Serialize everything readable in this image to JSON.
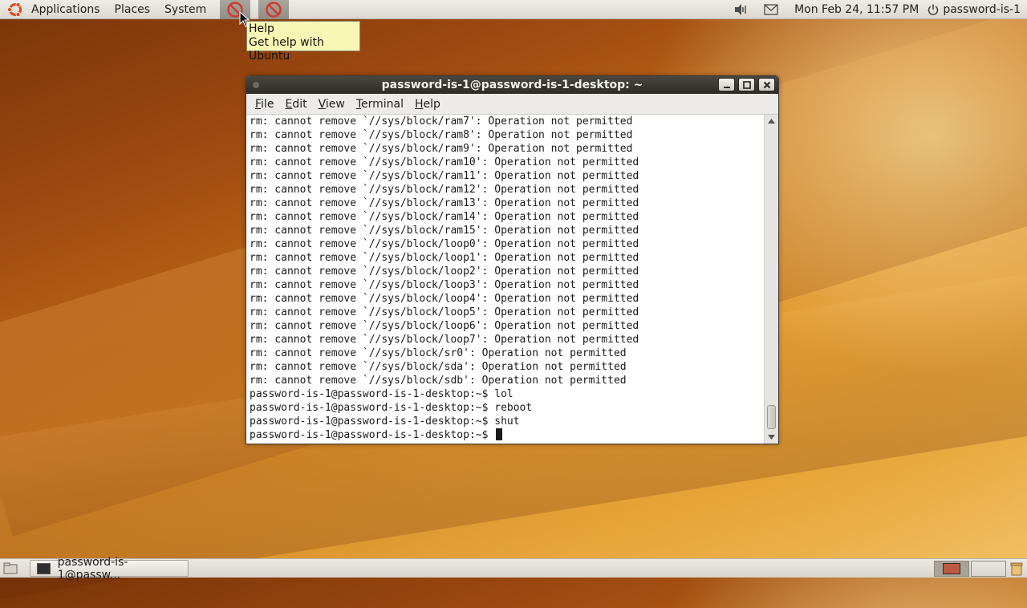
{
  "top_panel": {
    "menus": [
      "Applications",
      "Places",
      "System"
    ],
    "clock": "Mon Feb 24, 11:57 PM",
    "user": "password-is-1"
  },
  "tooltip": {
    "title": "Help",
    "text": "Get help with Ubuntu"
  },
  "terminal": {
    "title": "password-is-1@password-is-1-desktop: ~",
    "menu": [
      "File",
      "Edit",
      "View",
      "Terminal",
      "Help"
    ],
    "lines": [
      "rm: cannot remove `//sys/block/ram7': Operation not permitted",
      "rm: cannot remove `//sys/block/ram8': Operation not permitted",
      "rm: cannot remove `//sys/block/ram9': Operation not permitted",
      "rm: cannot remove `//sys/block/ram10': Operation not permitted",
      "rm: cannot remove `//sys/block/ram11': Operation not permitted",
      "rm: cannot remove `//sys/block/ram12': Operation not permitted",
      "rm: cannot remove `//sys/block/ram13': Operation not permitted",
      "rm: cannot remove `//sys/block/ram14': Operation not permitted",
      "rm: cannot remove `//sys/block/ram15': Operation not permitted",
      "rm: cannot remove `//sys/block/loop0': Operation not permitted",
      "rm: cannot remove `//sys/block/loop1': Operation not permitted",
      "rm: cannot remove `//sys/block/loop2': Operation not permitted",
      "rm: cannot remove `//sys/block/loop3': Operation not permitted",
      "rm: cannot remove `//sys/block/loop4': Operation not permitted",
      "rm: cannot remove `//sys/block/loop5': Operation not permitted",
      "rm: cannot remove `//sys/block/loop6': Operation not permitted",
      "rm: cannot remove `//sys/block/loop7': Operation not permitted",
      "rm: cannot remove `//sys/block/sr0': Operation not permitted",
      "rm: cannot remove `//sys/block/sda': Operation not permitted",
      "rm: cannot remove `//sys/block/sdb': Operation not permitted",
      "password-is-1@password-is-1-desktop:~$ lol",
      "password-is-1@password-is-1-desktop:~$ reboot",
      "password-is-1@password-is-1-desktop:~$ shut",
      "password-is-1@password-is-1-desktop:~$ "
    ]
  },
  "taskbar": {
    "task_label": "password-is-1@passw..."
  },
  "icons": {
    "launcher_1": "no-entry-icon",
    "launcher_2": "no-entry-icon",
    "volume": "volume-icon",
    "mail": "mail-icon",
    "power": "power-icon"
  },
  "colors": {
    "panel": "#dcd8d1",
    "titlebar": "#3a3631",
    "tooltip": "#f8f6b4",
    "no_entry": "#d23a2a"
  }
}
